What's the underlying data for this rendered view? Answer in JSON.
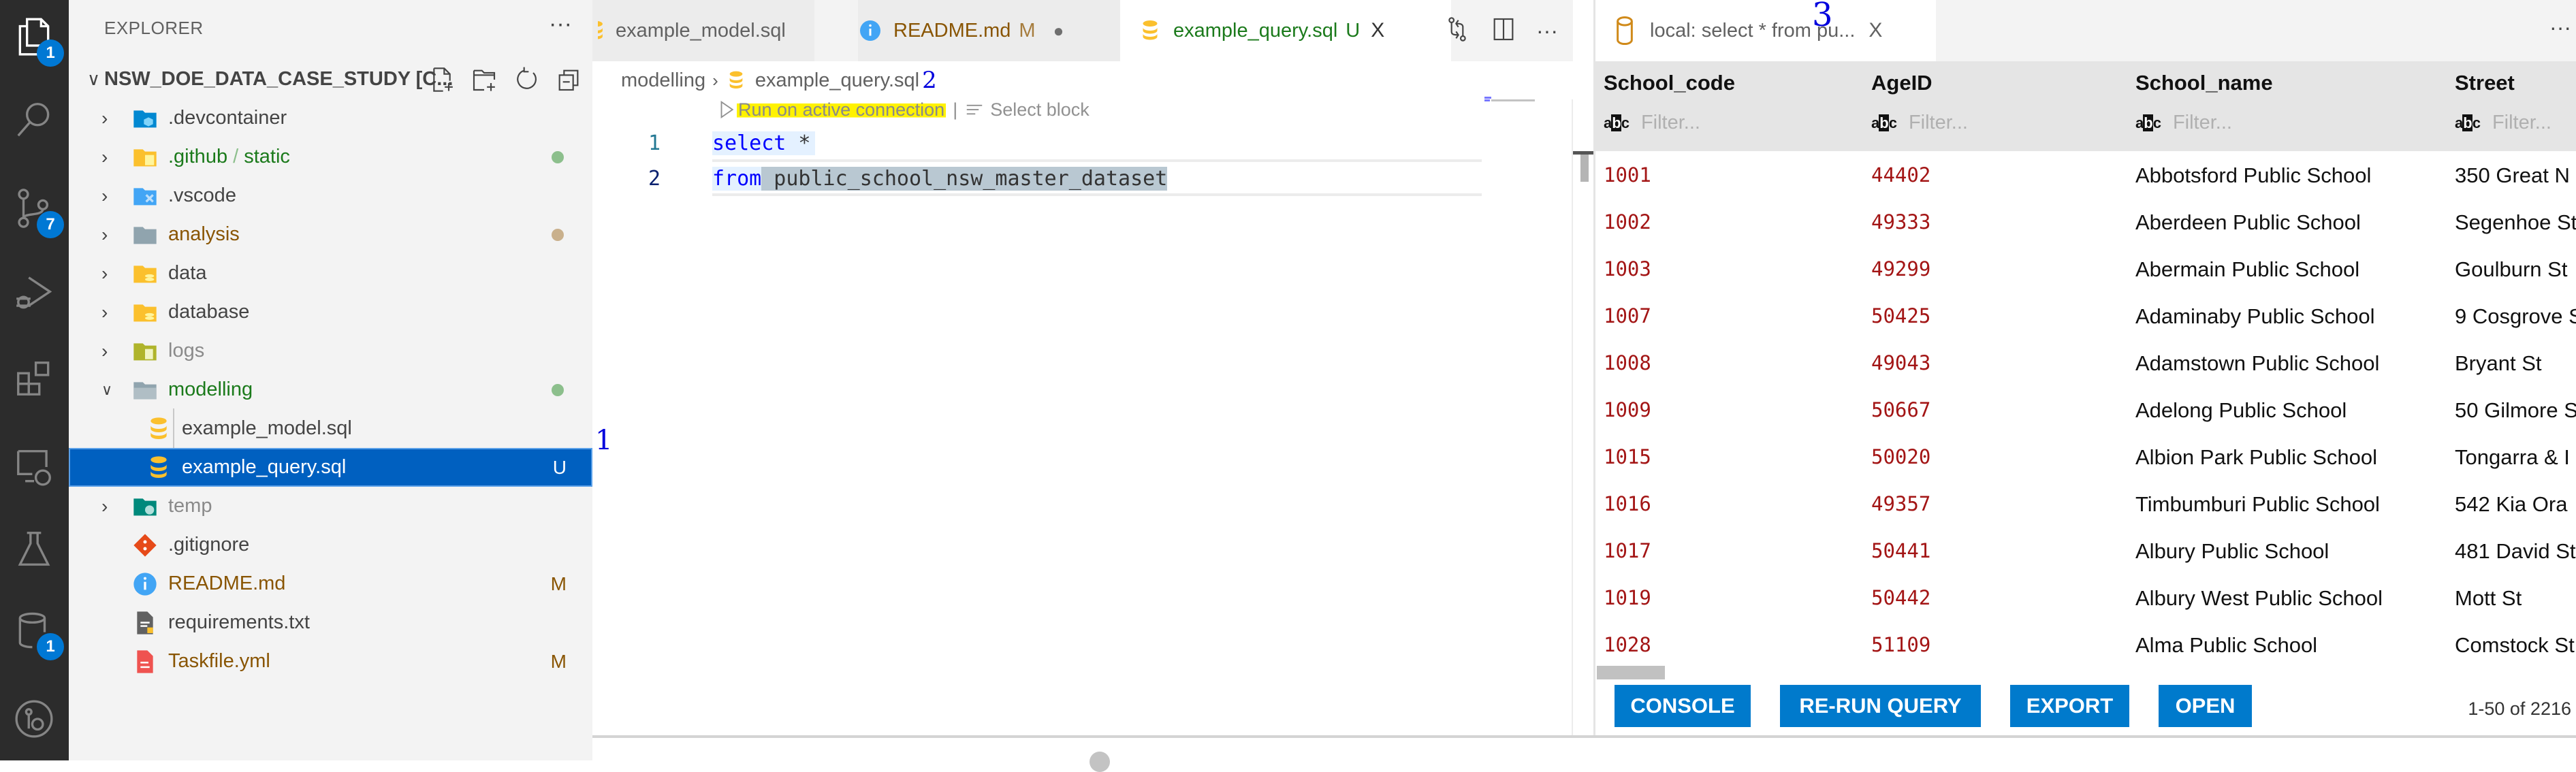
{
  "activity_bar": {
    "items": [
      {
        "name": "explorer",
        "badge": "1"
      },
      {
        "name": "search"
      },
      {
        "name": "source-control",
        "badge": "7"
      },
      {
        "name": "run-debug"
      },
      {
        "name": "extensions"
      },
      {
        "name": "remote-explorer"
      },
      {
        "name": "testing"
      },
      {
        "name": "database",
        "badge": "1"
      },
      {
        "name": "gitlens"
      }
    ]
  },
  "explorer": {
    "title": "EXPLORER",
    "more": "···",
    "root": "NSW_DOE_DATA_CASE_STUDY [C...",
    "items": [
      {
        "label": ".devcontainer",
        "type": "folder",
        "color": "#444444"
      },
      {
        "label": ".github",
        "label2": "static",
        "type": "folder",
        "color": "#1b7a1b",
        "dot": "#8cbf8c"
      },
      {
        "label": ".vscode",
        "type": "folder",
        "color": "#444444"
      },
      {
        "label": "analysis",
        "type": "folder",
        "color": "#895503",
        "dot": "#c9b08c"
      },
      {
        "label": "data",
        "type": "folder",
        "color": "#444444"
      },
      {
        "label": "database",
        "type": "folder",
        "color": "#444444"
      },
      {
        "label": "logs",
        "type": "folder",
        "color": "#8a8a8a"
      },
      {
        "label": "modelling",
        "type": "folder-open",
        "color": "#1b7a1b",
        "dot": "#8cbf8c"
      },
      {
        "label": "example_model.sql",
        "type": "file",
        "color": "#444444"
      },
      {
        "label": "example_query.sql",
        "type": "file",
        "color": "#ffffff",
        "deco": "U",
        "selected": true
      },
      {
        "label": "temp",
        "type": "folder",
        "color": "#8a8a8a"
      },
      {
        "label": ".gitignore",
        "type": "file",
        "color": "#444444"
      },
      {
        "label": "README.md",
        "type": "file",
        "color": "#895503",
        "deco": "M"
      },
      {
        "label": "requirements.txt",
        "type": "file",
        "color": "#444444"
      },
      {
        "label": "Taskfile.yml",
        "type": "file",
        "color": "#895503",
        "deco": "M"
      }
    ]
  },
  "editor": {
    "tabs": [
      {
        "label": "example_model.sql",
        "color": "#616161"
      },
      {
        "label": "README.md",
        "mod": "M",
        "color": "#895503",
        "dirty": "●"
      },
      {
        "label": "example_query.sql",
        "mod": "U",
        "color": "#1b7a1b",
        "close": "X",
        "active": true
      }
    ],
    "more": "···",
    "breadcrumb": [
      "modelling",
      "example_query.sql"
    ],
    "codelens": {
      "run": "Run on active connection",
      "sep": "|",
      "select": "Select block"
    },
    "lines": [
      {
        "num": "1",
        "kw": "select",
        "rest": " *"
      },
      {
        "num": "2",
        "kw": "from",
        "rest": " public_school_nsw_master_dataset"
      }
    ]
  },
  "results": {
    "tab_label": "local: select * from pu...",
    "tab_close": "X",
    "more": "···",
    "columns": [
      "School_code",
      "AgeID",
      "School_name",
      "Street"
    ],
    "filter_placeholder": "Filter...",
    "filter_icon": "abc",
    "rows": [
      [
        "1001",
        "44402",
        "Abbotsford Public School",
        "350 Great N"
      ],
      [
        "1002",
        "49333",
        "Aberdeen Public School",
        "Segenhoe St"
      ],
      [
        "1003",
        "49299",
        "Abermain Public School",
        "Goulburn St"
      ],
      [
        "1007",
        "50425",
        "Adaminaby Public School",
        "9 Cosgrove S"
      ],
      [
        "1008",
        "49043",
        "Adamstown Public School",
        "Bryant St"
      ],
      [
        "1009",
        "50667",
        "Adelong Public School",
        "50 Gilmore S"
      ],
      [
        "1015",
        "50020",
        "Albion Park Public School",
        "Tongarra & I"
      ],
      [
        "1016",
        "49357",
        "Timbumburi Public School",
        "542 Kia Ora"
      ],
      [
        "1017",
        "50441",
        "Albury Public School",
        "481 David St"
      ],
      [
        "1019",
        "50442",
        "Albury West Public School",
        "Mott St"
      ],
      [
        "1028",
        "51109",
        "Alma Public School",
        "Comstock St"
      ]
    ],
    "buttons": [
      "CONSOLE",
      "RE-RUN QUERY",
      "EXPORT",
      "OPEN"
    ],
    "pager": "1-50 of 2216"
  },
  "annotations": [
    "1",
    "2",
    "3"
  ],
  "colors": {
    "accent": "#007acc",
    "selection": "#0060c0",
    "number": "#a31515",
    "keyword": "#0000ff",
    "highlight": "#fff200"
  }
}
